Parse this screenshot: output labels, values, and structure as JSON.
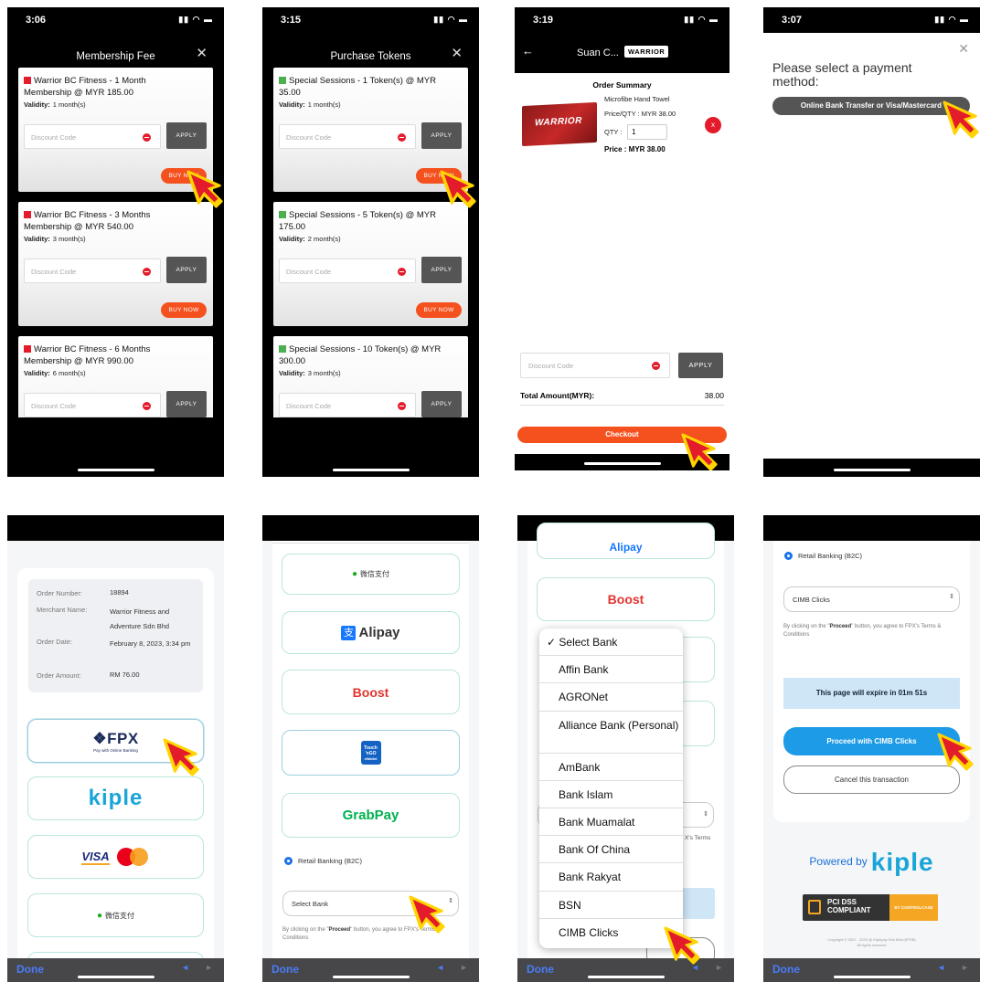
{
  "p1": {
    "time": "3:06",
    "title": "Membership Fee",
    "close": "✕",
    "cards": [
      {
        "line1": "Warrior BC Fitness - 1 Month",
        "line2": "Membership @ MYR 185.00",
        "validity_label": "Validity:",
        "validity": "1 month(s)"
      },
      {
        "line1": "Warrior BC Fitness - 3 Months",
        "line2": "Membership @ MYR 540.00",
        "validity_label": "Validity:",
        "validity": "3 month(s)"
      },
      {
        "line1": "Warrior BC Fitness - 6 Months",
        "line2": "Membership @ MYR 990.00",
        "validity_label": "Validity:",
        "validity": "6 month(s)"
      }
    ],
    "discount_placeholder": "Discount Code",
    "apply": "APPLY",
    "buy": "BUY NOW",
    "color": "#e31b2b"
  },
  "p2": {
    "time": "3:15",
    "title": "Purchase Tokens",
    "close": "✕",
    "cards": [
      {
        "line1": "Special Sessions - 1 Token(s) @ MYR",
        "line2": "35.00",
        "validity_label": "Validity:",
        "validity": "1 month(s)"
      },
      {
        "line1": "Special Sessions - 5 Token(s) @ MYR",
        "line2": "175.00",
        "validity_label": "Validity:",
        "validity": "2 month(s)"
      },
      {
        "line1": "Special Sessions - 10 Token(s) @ MYR",
        "line2": "300.00",
        "validity_label": "Validity:",
        "validity": "3 month(s)"
      }
    ],
    "discount_placeholder": "Discount Code",
    "apply": "APPLY",
    "buy": "BUY NOW",
    "color": "#4caf50"
  },
  "p3": {
    "time": "3:19",
    "back": "←",
    "title": "Suan C...",
    "badge": "WARRIOR",
    "summary": "Order Summary",
    "product": "Microfibe Hand Towel",
    "price_qty": "Price/QTY : MYR 38.00",
    "qty_label": "QTY :",
    "qty": "1",
    "price": "Price : MYR 38.00",
    "towel_text": "WARRIOR",
    "remove": "x",
    "discount_placeholder": "Discount Code",
    "apply": "APPLY",
    "total_label": "Total Amount(MYR):",
    "total": "38.00",
    "checkout": "Checkout"
  },
  "p4": {
    "time": "3:07",
    "close": "✕",
    "prompt": "Please select a payment method:",
    "option": "Online Bank Transfer or Visa/Mastercard"
  },
  "p5": {
    "rows": [
      {
        "label": "Order Number:",
        "value": "18894"
      },
      {
        "label": "Merchant Name:",
        "value": "Warrior Fitness and Adventure Sdn Bhd"
      },
      {
        "label": "Order Date:",
        "value": "February 8, 2023, 3:34 pm"
      },
      {
        "label": "Order Amount:",
        "value": "RM 76.00"
      }
    ],
    "fpx": "FPX",
    "fpx_sub": "Pay with Online Banking",
    "kiple": "kiple",
    "visa": "VISA",
    "wechat": "微信支付",
    "done": "Done"
  },
  "p6": {
    "wechat": "微信支付",
    "alipay": "Alipay",
    "boost": "Boost",
    "tng1": "Touch",
    "tng2": "'nGO",
    "tng3": "eWallet",
    "grab": "GrabPay",
    "retail": "Retail Banking (B2C)",
    "select": "Select Bank",
    "terms_pre": "By clicking on the \"",
    "terms_b": "Proceed",
    "terms_post": "\" button, you agree to FPX's Terms & Conditions",
    "done": "Done"
  },
  "p7": {
    "alipay": "Alipay",
    "boost": "Boost",
    "terms_frag": "X's Terms",
    "banks": [
      "✓ Select Bank",
      "Affin Bank",
      "AGRONet",
      "Alliance Bank (Personal)",
      "AmBank",
      "Bank Islam",
      "Bank Muamalat",
      "Bank Of China",
      "Bank Rakyat",
      "BSN",
      "CIMB Clicks"
    ],
    "done": "Done"
  },
  "p8": {
    "retail": "Retail Banking (B2C)",
    "select": "CIMB Clicks",
    "terms_pre": "By clicking on the \"",
    "terms_b": "Proceed",
    "terms_post": "\" button, you agree to FPX's Terms & Conditions",
    "expire": "This page will expire in 01m 51s",
    "proceed": "Proceed with CIMB Clicks",
    "cancel": "Cancel this transaction",
    "powered": "Powered by",
    "kiple": "kiple",
    "pci1": "PCI DSS",
    "pci2": "COMPLIANT",
    "pci3": "BY CONTROLCASE",
    "copy1": "Copyright © 2007 - 2023 @ Kiplepay Sdn Bhd (KPSB)",
    "copy2": "All rights reserved",
    "done": "Done"
  }
}
